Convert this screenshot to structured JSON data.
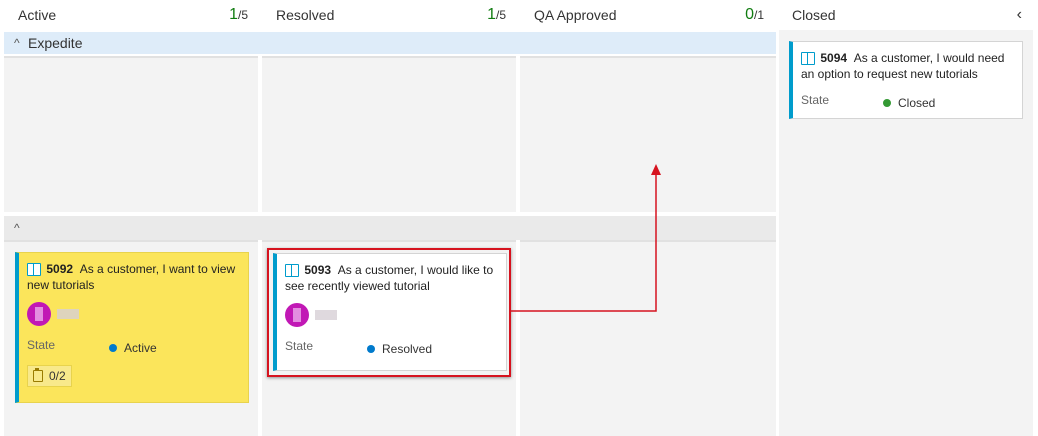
{
  "columns": [
    {
      "title": "Active",
      "wip_current": "1",
      "wip_limit": "/5"
    },
    {
      "title": "Resolved",
      "wip_current": "1",
      "wip_limit": "/5"
    },
    {
      "title": "QA Approved",
      "wip_current": "0",
      "wip_limit": "/1"
    },
    {
      "title": "Closed",
      "chevron": "‹"
    }
  ],
  "swimlanes": [
    {
      "title": "Expedite",
      "chevron": "^"
    },
    {
      "title": "",
      "chevron": "^"
    }
  ],
  "cards": {
    "c5092": {
      "id": "5092",
      "title": "As a customer, I want to view new tutorials",
      "state_label": "State",
      "state": "Active",
      "state_color": "#007acc",
      "tasks": "0/2"
    },
    "c5093": {
      "id": "5093",
      "title": "As a customer, I would like to see recently viewed tutorial",
      "state_label": "State",
      "state": "Resolved",
      "state_color": "#007acc"
    },
    "c5094": {
      "id": "5094",
      "title": "As a customer, I would need an option to request new tutorials",
      "state_label": "State",
      "state": "Closed",
      "state_color": "#339933"
    }
  },
  "colors": {
    "accent_blue": "#009ccc",
    "wip_green": "#107c10",
    "card_yellow": "#fbe55b",
    "annotation_red": "#d6131f"
  }
}
